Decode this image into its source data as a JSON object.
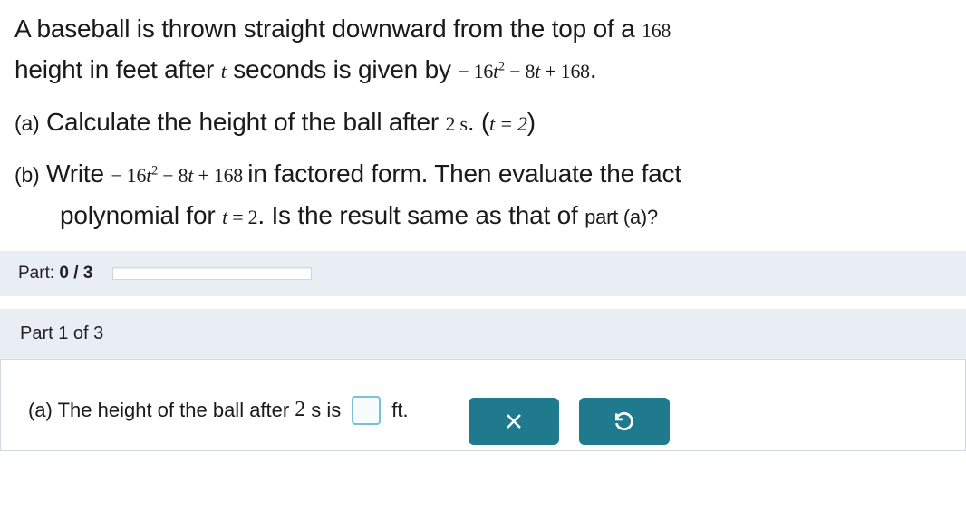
{
  "problem": {
    "line1_a": "A baseball is thrown straight downward from the top of a ",
    "line1_b": "168",
    "line2_a": "height in feet after ",
    "line2_var": "t",
    "line2_b": " seconds is given by ",
    "line2_formula": "−16t² − 8t + 168",
    "line2_c": "."
  },
  "part_a": {
    "label": "(a)",
    "text1": " Calculate the height of the ball after ",
    "time": "2 s",
    "text2": ". (",
    "cond": "t = 2",
    "text3": ")"
  },
  "part_b": {
    "label": "(b)",
    "text1": " Write ",
    "formula": "−16t² − 8t + 168",
    "text2": " in factored form. Then evaluate the fact",
    "line2a": "polynomial for ",
    "cond": "t = 2",
    "line2b": ". Is the result same as that of ",
    "ref": "part (a)?"
  },
  "progress": {
    "label_prefix": "Part: ",
    "current": "0",
    "sep": " / ",
    "total": "3"
  },
  "subpart": {
    "label": "Part 1 of 3"
  },
  "answer": {
    "prefix": "(a) The height of the ball after ",
    "time_num": "2",
    "time_unit": " s is",
    "unit": "ft."
  },
  "buttons": {
    "clear": "clear",
    "reset": "reset"
  }
}
